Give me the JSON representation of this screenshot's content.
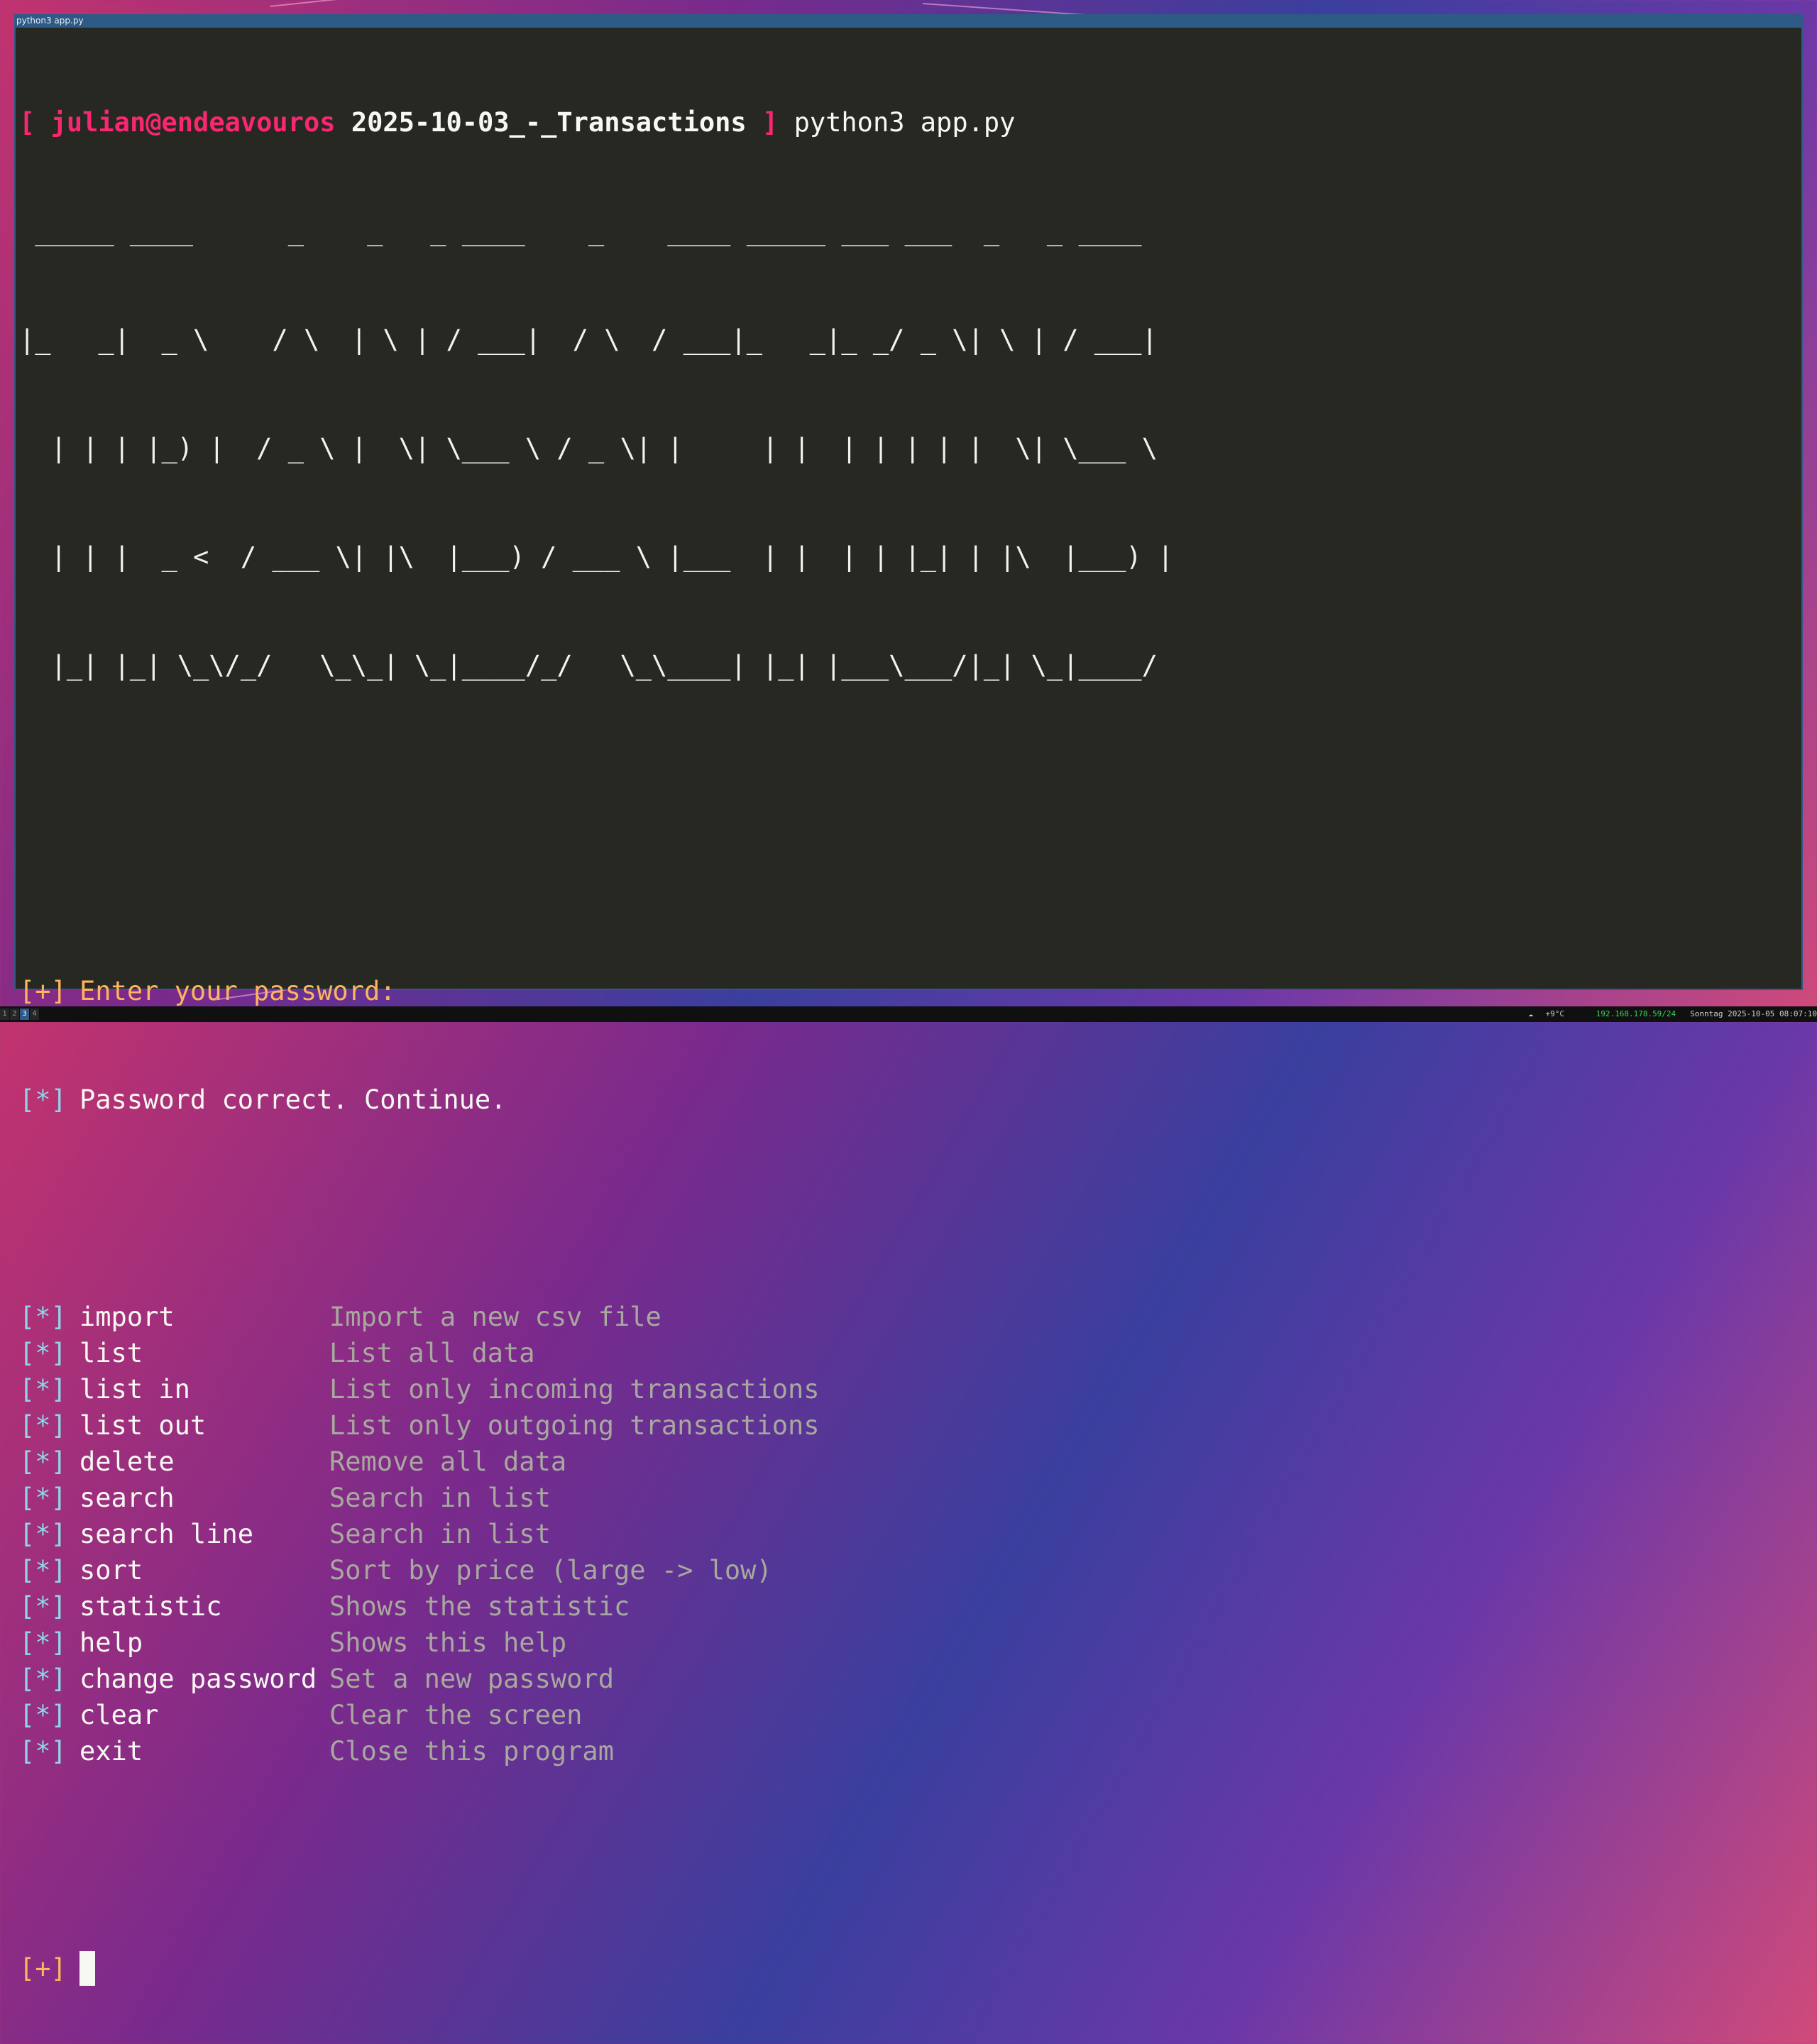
{
  "window": {
    "title": "python3 app.py"
  },
  "prompt": {
    "open": "[",
    "user_host": "julian@endeavouros",
    "directory": "2025-10-03_-_Transactions",
    "close": "]",
    "command": "python3 app.py"
  },
  "banner_lines": [
    " _____ ____      _    _   _ ____    _    ____ _____ ___ ___  _   _ ____  ",
    "|_   _|  _ \\    / \\  | \\ | / ___|  / \\  / ___|_   _|_ _/ _ \\| \\ | / ___| ",
    "  | | | |_) |  / _ \\ |  \\| \\___ \\ / _ \\| |     | |  | | | | |  \\| \\___ \\ ",
    "  | | |  _ <  / ___ \\| |\\  |___) / ___ \\ |___  | |  | | |_| | |\\  |___) |",
    "  |_| |_| \\_\\/_/   \\_\\_| \\_|____/_/   \\_\\____| |_| |___\\___/|_| \\_|____/ "
  ],
  "password_prompt": {
    "prefix": "[+]",
    "text": "Enter your password:"
  },
  "password_ok": {
    "prefix": "[*]",
    "text": "Password correct. Continue."
  },
  "help_prefix": "[*]",
  "commands": [
    {
      "name": "import",
      "desc": "Import a new csv file"
    },
    {
      "name": "list",
      "desc": "List all data"
    },
    {
      "name": "list in",
      "desc": "List only incoming transactions"
    },
    {
      "name": "list out",
      "desc": "List only outgoing transactions"
    },
    {
      "name": "delete",
      "desc": "Remove all data"
    },
    {
      "name": "search",
      "desc": "Search in list"
    },
    {
      "name": "search line",
      "desc": "Search in list"
    },
    {
      "name": "sort",
      "desc": "Sort by price (large -> low)"
    },
    {
      "name": "statistic",
      "desc": "Shows the statistic"
    },
    {
      "name": "help",
      "desc": "Shows this help"
    },
    {
      "name": "change password",
      "desc": "Set a new password"
    },
    {
      "name": "clear",
      "desc": "Clear the screen"
    },
    {
      "name": "exit",
      "desc": "Close this program"
    }
  ],
  "input_prompt": {
    "prefix": "[+]"
  },
  "statusbar": {
    "workspaces": [
      "1",
      "2",
      "3",
      "4"
    ],
    "active_workspace": "3",
    "weather_icon": "cloud-icon",
    "temperature": "+9°C",
    "ip": "192.168.178.59/24",
    "datetime": "Sonntag 2025-10-05 08:07:10"
  },
  "colors": {
    "terminal_bg": "#272822",
    "accent_pink": "#f92672",
    "prompt_orange": "#fdb35f",
    "bracket_cyan": "#8fd4e6",
    "ip_green": "#39d353"
  }
}
